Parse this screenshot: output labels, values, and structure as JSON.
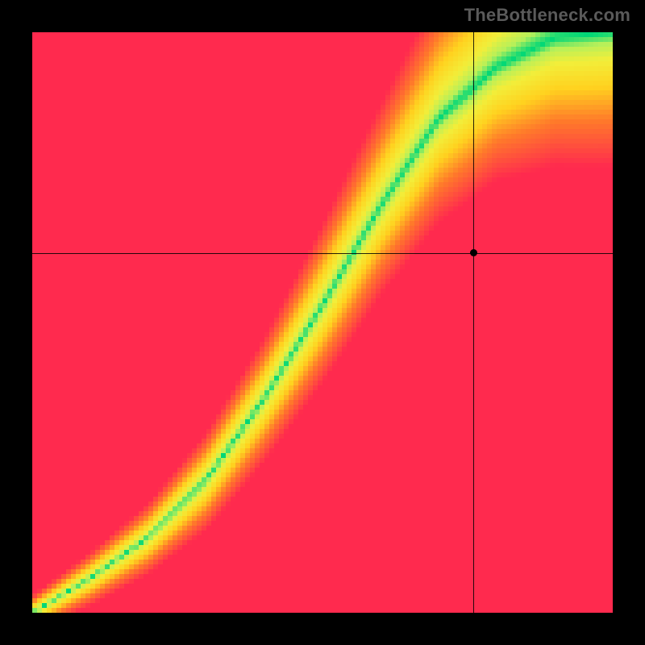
{
  "attribution": "TheBottleneck.com",
  "chart_data": {
    "type": "heatmap",
    "title": "",
    "xlabel": "",
    "ylabel": "",
    "xlim": [
      0,
      1
    ],
    "ylim": [
      0,
      1
    ],
    "grid_resolution": 120,
    "marker": {
      "x": 0.76,
      "y": 0.62
    },
    "crosshair": {
      "x": 0.76,
      "y": 0.62
    },
    "ideal_curve_desc": "Green optimal band follows a monotone curve from bottom-left to top-right; band is narrow near origin, widens toward top-right.",
    "ideal_curve_samples": [
      {
        "x": 0.0,
        "y": 0.0
      },
      {
        "x": 0.1,
        "y": 0.06
      },
      {
        "x": 0.2,
        "y": 0.13
      },
      {
        "x": 0.3,
        "y": 0.23
      },
      {
        "x": 0.4,
        "y": 0.37
      },
      {
        "x": 0.5,
        "y": 0.53
      },
      {
        "x": 0.6,
        "y": 0.7
      },
      {
        "x": 0.7,
        "y": 0.85
      },
      {
        "x": 0.8,
        "y": 0.94
      },
      {
        "x": 0.9,
        "y": 0.99
      },
      {
        "x": 1.0,
        "y": 1.0
      }
    ],
    "band_halfwidth_samples": [
      {
        "x": 0.0,
        "w": 0.01
      },
      {
        "x": 0.2,
        "w": 0.02
      },
      {
        "x": 0.4,
        "w": 0.035
      },
      {
        "x": 0.6,
        "w": 0.055
      },
      {
        "x": 0.8,
        "w": 0.085
      },
      {
        "x": 1.0,
        "w": 0.14
      }
    ],
    "colorscale": [
      {
        "stop": 0.0,
        "color": "#ff2a4e"
      },
      {
        "stop": 0.35,
        "color": "#ff7a2a"
      },
      {
        "stop": 0.6,
        "color": "#ffd21f"
      },
      {
        "stop": 0.8,
        "color": "#f2ee3a"
      },
      {
        "stop": 0.92,
        "color": "#b6f05a"
      },
      {
        "stop": 1.0,
        "color": "#00d777"
      }
    ]
  }
}
